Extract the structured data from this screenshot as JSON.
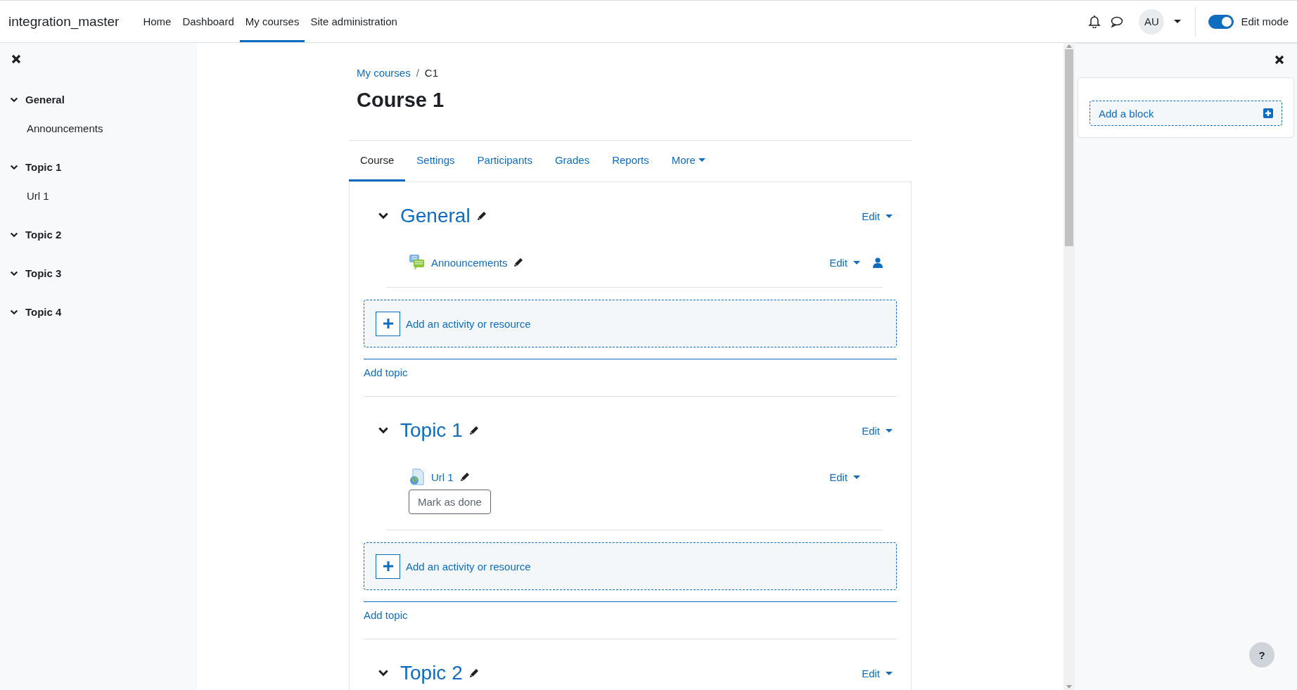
{
  "navbar": {
    "brand": "integration_master",
    "items": [
      {
        "label": "Home",
        "selected": false
      },
      {
        "label": "Dashboard",
        "selected": false
      },
      {
        "label": "My courses",
        "selected": true
      },
      {
        "label": "Site administration",
        "selected": false
      }
    ],
    "avatar": "AU",
    "edit_mode": {
      "label": "Edit mode",
      "on": true
    }
  },
  "course_index": {
    "items": [
      {
        "label": "General",
        "expanded": true,
        "children": [
          {
            "label": "Announcements"
          }
        ]
      },
      {
        "label": "Topic 1",
        "expanded": true,
        "children": [
          {
            "label": "Url 1"
          }
        ]
      },
      {
        "label": "Topic 2",
        "expanded": true
      },
      {
        "label": "Topic 3",
        "expanded": true
      },
      {
        "label": "Topic 4",
        "expanded": true
      }
    ]
  },
  "breadcrumb": {
    "separator": "/",
    "items": [
      {
        "label": "My courses",
        "kind": "link"
      },
      {
        "label": "C1",
        "kind": "current"
      }
    ]
  },
  "page_title": "Course 1",
  "tabs": [
    {
      "label": "Course",
      "selected": true,
      "dropdown": false
    },
    {
      "label": "Settings",
      "selected": false,
      "dropdown": false
    },
    {
      "label": "Participants",
      "selected": false,
      "dropdown": false
    },
    {
      "label": "Grades",
      "selected": false,
      "dropdown": false
    },
    {
      "label": "Reports",
      "selected": false,
      "dropdown": false
    },
    {
      "label": "More",
      "selected": false,
      "dropdown": true
    }
  ],
  "sections": [
    {
      "title": "General",
      "expanded": true,
      "edit": "Edit",
      "activities": [
        {
          "kind": "forum",
          "name": "Announcements",
          "edit": "Edit",
          "group_restricted": true
        }
      ],
      "add_activity": "Add an activity or resource",
      "add_topic": "Add topic"
    },
    {
      "title": "Topic 1",
      "expanded": true,
      "edit": "Edit",
      "activities": [
        {
          "kind": "url",
          "name": "Url 1",
          "edit": "Edit",
          "group_restricted": false,
          "completion_button": "Mark as done"
        }
      ],
      "add_activity": "Add an activity or resource",
      "add_topic": "Add topic"
    },
    {
      "title": "Topic 2",
      "expanded": true,
      "edit": "Edit"
    }
  ],
  "block_drawer": {
    "add_block": "Add a block"
  },
  "help_button": "?"
}
